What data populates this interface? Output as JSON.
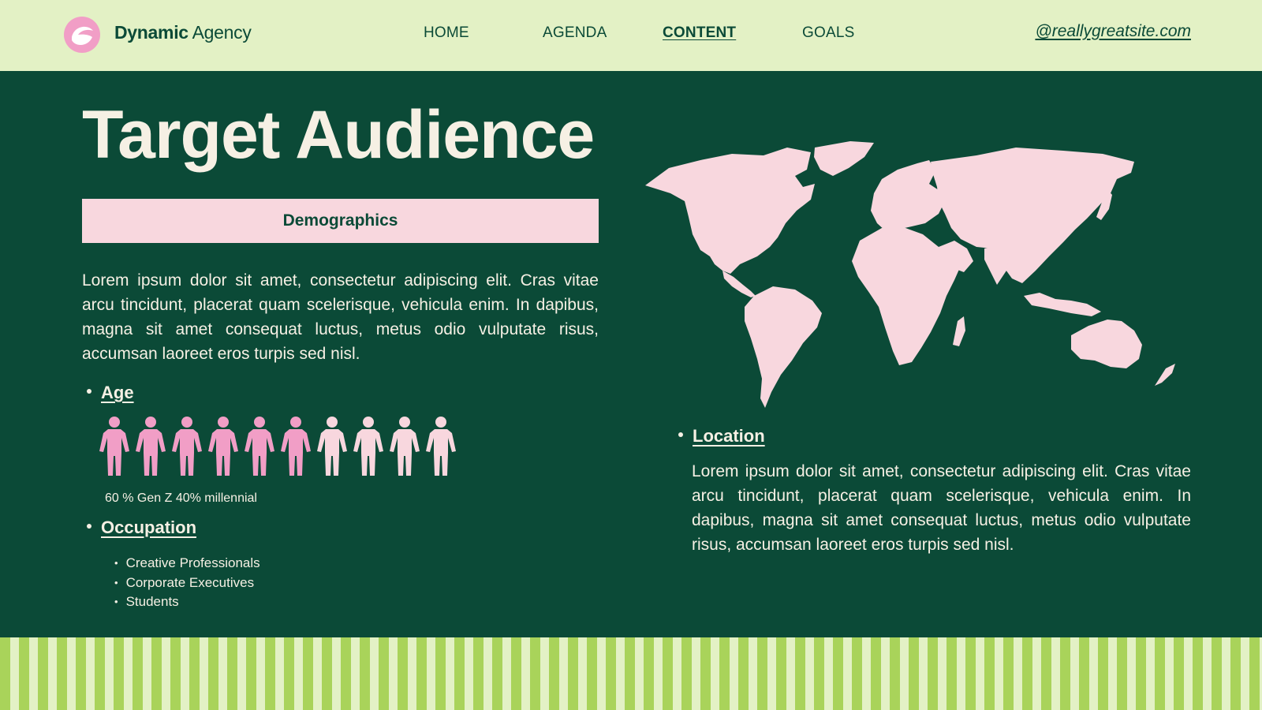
{
  "header": {
    "brand_bold": "Dynamic",
    "brand_light": "Agency",
    "nav": [
      {
        "label": "HOME",
        "active": false
      },
      {
        "label": "AGENDA",
        "active": false
      },
      {
        "label": "CONTENT",
        "active": true
      },
      {
        "label": "GOALS",
        "active": false
      }
    ],
    "site_link": "@reallygreatsite.com"
  },
  "main": {
    "title": "Target Audience",
    "demographics_label": "Demographics",
    "intro": "Lorem ipsum dolor sit amet, consectetur adipiscing elit. Cras vitae arcu tincidunt, placerat quam scelerisque, vehicula enim. In dapibus, magna sit amet consequat luctus, metus odio vulputate risus, accumsan laoreet eros turpis sed nisl.",
    "age": {
      "label": "Age",
      "caption": "60 % Gen Z 40% millennial",
      "gen_z_count": 6,
      "millennial_count": 4
    },
    "occupation": {
      "label": "Occupation",
      "items": [
        "Creative Professionals",
        "Corporate Executives",
        "Students"
      ]
    },
    "location": {
      "label": "Location",
      "text": "Lorem ipsum dolor sit amet, consectetur adipiscing elit. Cras vitae arcu tincidunt, placerat quam scelerisque, vehicula enim. In dapibus, magna sit amet consequat luctus, metus odio vulputate risus, accumsan laoreet eros turpis sed nisl."
    }
  },
  "icons": {
    "logo": "logo-icon",
    "person": "person-icon",
    "map": "world-map"
  },
  "colors": {
    "background": "#0b4a37",
    "header_bg": "#e3f1c5",
    "accent_pink": "#f19ec6",
    "light_pink": "#f8d7de",
    "cream": "#f6f0e4",
    "stripe_green": "#a9d35a"
  }
}
